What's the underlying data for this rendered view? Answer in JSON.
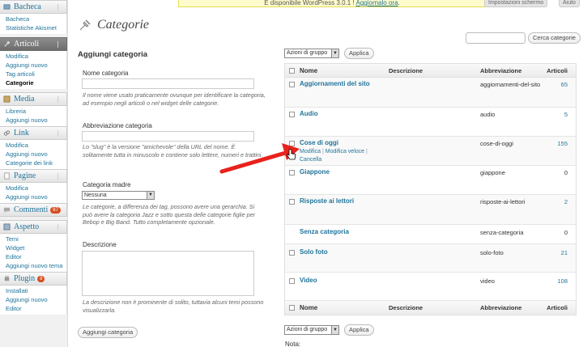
{
  "notice": {
    "text": "È disponibile WordPress 3.0.1 ! ",
    "link": "Aggiornalo ora",
    "tail": "."
  },
  "header_tabs": {
    "screen_options": "Impostazioni schermo",
    "help": "Aiuto"
  },
  "sidebar": {
    "bacheca": {
      "label": "Bacheca",
      "items": [
        "Bacheca",
        "Statistiche Akismet"
      ]
    },
    "articoli": {
      "label": "Articoli",
      "items": [
        "Modifica",
        "Aggiungi nuovo",
        "Tag articoli",
        "Categorie"
      ]
    },
    "media": {
      "label": "Media",
      "items": [
        "Libreria",
        "Aggiungi nuovo"
      ]
    },
    "link": {
      "label": "Link",
      "items": [
        "Modifica",
        "Aggiungi nuovo",
        "Categorie dei link"
      ]
    },
    "pagine": {
      "label": "Pagine",
      "items": [
        "Modifica",
        "Aggiungi nuovo"
      ]
    },
    "commenti": {
      "label": "Commenti",
      "badge": "87"
    },
    "aspetto": {
      "label": "Aspetto",
      "items": [
        "Temi",
        "Widget",
        "Editor",
        "Aggiungi nuovo tema"
      ]
    },
    "plugin": {
      "label": "Plugin",
      "badge": "8",
      "items": [
        "Installati",
        "Aggiungi nuovo",
        "Editor"
      ]
    }
  },
  "page": {
    "title": "Categorie"
  },
  "search": {
    "button": "Cerca categorie",
    "value": ""
  },
  "form": {
    "title": "Aggiungi categoria",
    "name_label": "Nome categoria",
    "name_desc": "Il nome viene usato praticamente ovunque per identificare la categoria, ad esempio negli articoli o nel widget delle categorie.",
    "slug_label": "Abbreviazione categoria",
    "slug_desc": "Lo \"slug\" è la versione \"amichevole\" della URL del nome. È solitamente tutta in minuscolo e contiene solo lettere, numeri e trattini.",
    "parent_label": "Categoria madre",
    "parent_value": "Nessuna",
    "parent_desc": "Le categorie, a differenza dei tag, possono avere una gerarchia. Si può avere la categoria Jazz e sotto questa delle categorie figlie per Bebop e Big Band. Tutto completamente opzionale.",
    "desc_label": "Descrizione",
    "desc_help": "La descrizione non è prominente di solito, tuttavia alcuni temi possono visualizzarla.",
    "submit": "Aggiungi categoria"
  },
  "bulk": {
    "select": "Azioni di gruppo",
    "apply": "Applica"
  },
  "table": {
    "headers": {
      "name": "Nome",
      "desc": "Descrizione",
      "slug": "Abbreviazione",
      "count": "Articoli"
    },
    "rows": [
      {
        "name": "Aggiornamenti del sito",
        "slug": "aggiornamenti-del-sito",
        "count": "65"
      },
      {
        "name": "Audio",
        "slug": "audio",
        "count": "5"
      },
      {
        "name": "Cose di oggi",
        "slug": "cose-di-oggi",
        "count": "155"
      },
      {
        "name": "Giappone",
        "slug": "giappone",
        "count": "0"
      },
      {
        "name": "Risposte ai lettori",
        "slug": "risposte-ai-lettori",
        "count": "2"
      },
      {
        "name": "Senza categoria",
        "slug": "senza-categoria",
        "count": "0"
      },
      {
        "name": "Solo foto",
        "slug": "solo-foto",
        "count": "21"
      },
      {
        "name": "Video",
        "slug": "video",
        "count": "108"
      }
    ],
    "row_actions": {
      "edit": "Modifica",
      "quick_edit": "Modifica veloce",
      "delete": "Cancella",
      "sep": " | "
    }
  },
  "nota": "Nota:",
  "colors": {
    "link": "#21759b",
    "arrow": "#e8221c"
  }
}
